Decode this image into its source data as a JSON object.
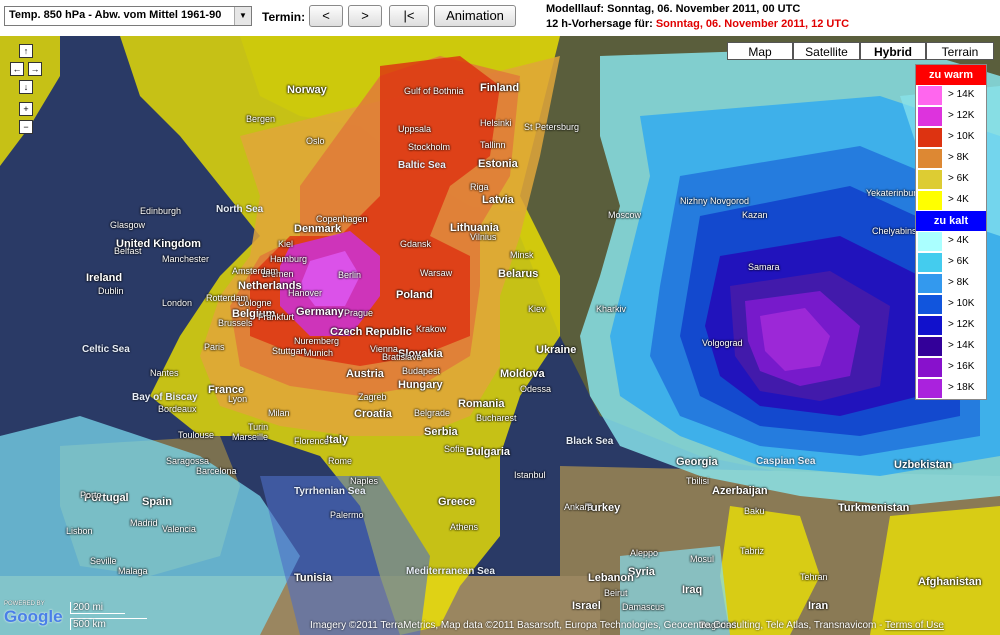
{
  "toolbar": {
    "parameter_select": "Temp. 850 hPa - Abw. vom Mittel 1961-90",
    "termin_label": "Termin:",
    "prev_label": "<",
    "next_label": ">",
    "first_label": "|<",
    "animation_label": "Animation"
  },
  "info": {
    "modelllauf_prefix": "Modelllauf: ",
    "modelllauf_value": "Sonntag, 06. November 2011, 00 UTC",
    "forecast_prefix": "12 h-Vorhersage für: ",
    "forecast_value": "Sonntag, 06. November 2011, 12 UTC"
  },
  "map_types": [
    {
      "label": "Map",
      "active": false
    },
    {
      "label": "Satellite",
      "active": false
    },
    {
      "label": "Hybrid",
      "active": true
    },
    {
      "label": "Terrain",
      "active": false
    }
  ],
  "nav_controls": {
    "up": "↑",
    "left": "←",
    "right": "→",
    "down": "↓",
    "zoom_in": "+",
    "zoom_out": "−"
  },
  "legend": {
    "warm_header": "zu warm",
    "warm_header_color": "#ff0000",
    "warm": [
      {
        "label": "> 14K",
        "color": "#ff66ee"
      },
      {
        "label": "> 12K",
        "color": "#dd33dd"
      },
      {
        "label": "> 10K",
        "color": "#dd3311"
      },
      {
        "label": "> 8K",
        "color": "#dd8833"
      },
      {
        "label": "> 6K",
        "color": "#ddcc33"
      },
      {
        "label": "> 4K",
        "color": "#ffff00"
      }
    ],
    "cold_header": "zu kalt",
    "cold_header_color": "#0000ff",
    "cold": [
      {
        "label": "> 4K",
        "color": "#aaffff"
      },
      {
        "label": "> 6K",
        "color": "#44ccee"
      },
      {
        "label": "> 8K",
        "color": "#3399ee"
      },
      {
        "label": "> 10K",
        "color": "#1155dd"
      },
      {
        "label": "> 12K",
        "color": "#1111cc"
      },
      {
        "label": "> 14K",
        "color": "#330099"
      },
      {
        "label": "> 16K",
        "color": "#8811cc"
      },
      {
        "label": "> 18K",
        "color": "#aa22dd"
      }
    ]
  },
  "places_bold": [
    "Norway",
    "Finland",
    "Estonia",
    "Latvia",
    "Lithuania",
    "Belarus",
    "Ukraine",
    "Moldova",
    "Romania",
    "Bulgaria",
    "Greece",
    "Turkey",
    "Georgia",
    "Azerbaijan",
    "Turkmenistan",
    "Uzbekistan",
    "Afghanistan",
    "Iran",
    "Iraq",
    "Syria",
    "Lebanon",
    "Israel",
    "Tunisia",
    "Spain",
    "Portugal",
    "France",
    "Germany",
    "Poland",
    "Czech Republic",
    "Slovakia",
    "Hungary",
    "Austria",
    "Croatia",
    "Serbia",
    "Italy",
    "Belgium",
    "Netherlands",
    "Denmark",
    "United Kingdom",
    "Ireland"
  ],
  "places": [
    "Bergen",
    "Oslo",
    "Stockholm",
    "Uppsala",
    "Helsinki",
    "St Petersburg",
    "Tallinn",
    "Riga",
    "Vilnius",
    "Minsk",
    "Moscow",
    "Kazan",
    "Nizhny Novgorod",
    "Samara",
    "Volgograd",
    "Yekaterinburg",
    "Chelyabinsk",
    "Copenhagen",
    "Hamburg",
    "Kiel",
    "Bremen",
    "Hanover",
    "Berlin",
    "Gdansk",
    "Warsaw",
    "Krakow",
    "Prague",
    "Munich",
    "Nuremberg",
    "Frankfurt",
    "Cologne",
    "Stuttgart",
    "Vienna",
    "Bratislava",
    "Budapest",
    "Zagreb",
    "Belgrade",
    "Bucharest",
    "Sofia",
    "Athens",
    "Istanbul",
    "Ankara",
    "Kiev",
    "Kharkiv",
    "Odessa",
    "Edinburgh",
    "Glasgow",
    "Manchester",
    "London",
    "Dublin",
    "Belfast",
    "Paris",
    "Lyon",
    "Bordeaux",
    "Toulouse",
    "Marseille",
    "Nantes",
    "Rotterdam",
    "Amsterdam",
    "Brussels",
    "Madrid",
    "Barcelona",
    "Valencia",
    "Lisbon",
    "Porto",
    "Seville",
    "Malaga",
    "Saragossa",
    "Rome",
    "Naples",
    "Milan",
    "Turin",
    "Florence",
    "Palermo",
    "Tbilisi",
    "Baku",
    "Tehran",
    "Tabriz",
    "Aleppo",
    "Beirut",
    "Damascus",
    "Baghdad",
    "Mosul",
    "Minsk",
    "Gulf of Bothnia"
  ],
  "seas": [
    "North Sea",
    "Baltic Sea",
    "Celtic Sea",
    "Bay of Biscay",
    "Black Sea",
    "Caspian Sea",
    "Tyrrhenian Sea",
    "Mediterranean Sea"
  ],
  "copyright_prefix": "Imagery ©2011 TerraMetrics, Map data ©2011 Basarsoft, Europa Technologies, Geocentre Consulting, Tele Atlas, Transnavicom - ",
  "copyright_link": "Terms of Use",
  "scale_mi": "200 mi",
  "scale_km": "500 km",
  "powered_by": "POWERED BY",
  "google_logo": "Google"
}
